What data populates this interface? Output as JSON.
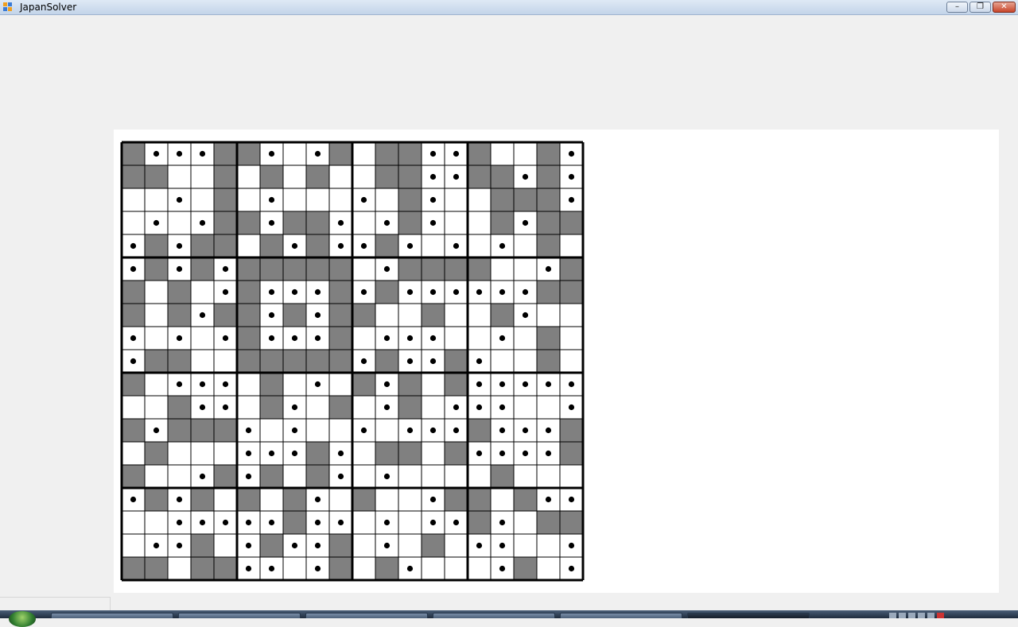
{
  "window": {
    "title": "JapanSolver",
    "minimize_symbol": "–",
    "maximize_symbol": "❐",
    "close_symbol": "✕",
    "icon": "app-icon"
  },
  "puzzle": {
    "rows": 19,
    "cols": 20,
    "block_size": 5,
    "legend": {
      "#": "filled",
      "o": "dot",
      ".": "empty"
    },
    "grid": [
      "#ooo##o.o#.##oo#..#o",
      "##..#.#.#..##oo##o#o",
      "..o.#.o...o.#o..###o",
      ".o.o##o##o.o#o..#o##",
      "o#o##.#o#oo#o.o.o.#.",
      "o#o#o#####.o####..o#o",
      "#.#.o#ooo#o#oooooo##.",
      "#.#o##o#o##..#..#o..",
      "o.o.o#ooo#.ooo..o.#.",
      "o##..#####o#oo#o..#.",
      "#.ooo.#.o.#o#.#ooooo",
      "..#oo.#o.#.o#.ooo..o",
      "#o###o.o..o.ooo#ooo#",
      ".#...ooo#o.##.#oooo#",
      "#..o#o#.#o.o....#...",
      "o#o#.#.#o.#..o##.#oo",
      "..ooooo#oo.o.oo#o.##",
      ".oo#.o#oo#.o.#.oo..o",
      "##.##oo.o#.#o...o#.o"
    ]
  },
  "colors": {
    "filled": "#808080",
    "dot": "#000000",
    "grid_line": "#000000",
    "panel_bg": "#ffffff",
    "window_bg": "#f0f0f0"
  },
  "taskbar": {
    "item_count": 6
  }
}
